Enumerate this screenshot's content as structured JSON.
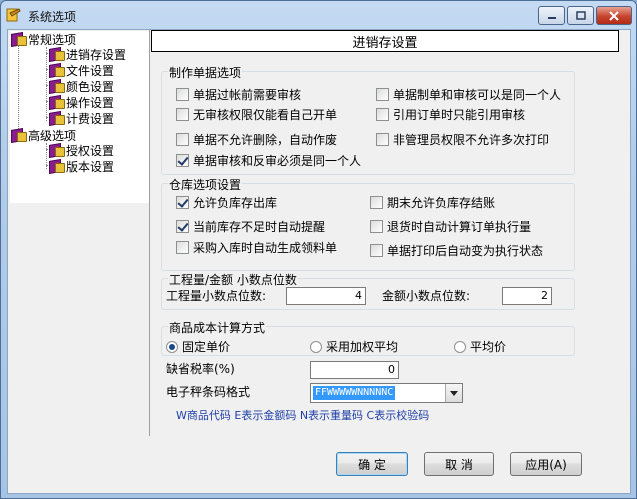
{
  "window": {
    "title": "系统选项"
  },
  "tree": {
    "general": "常规选项",
    "general_items": [
      "进销存设置",
      "文件设置",
      "颜色设置",
      "操作设置",
      "计费设置"
    ],
    "advanced": "高级选项",
    "advanced_items": [
      "授权设置",
      "版本设置"
    ]
  },
  "panel": {
    "header": "进销存设置",
    "doc_group": {
      "title": "制作单据选项",
      "options": [
        {
          "label": "单据过帐前需要审核",
          "checked": false
        },
        {
          "label": "单据制单和审核可以是同一个人",
          "checked": false
        },
        {
          "label": "无审核权限仅能看自己开单",
          "checked": false
        },
        {
          "label": "引用订单时只能引用审核",
          "checked": false
        },
        {
          "label": "单据不允许删除，自动作废",
          "checked": false
        },
        {
          "label": "非管理员权限不允许多次打印",
          "checked": false
        },
        {
          "label": "单据审核和反审必须是同一个人",
          "checked": true
        }
      ]
    },
    "stock_group": {
      "title": "仓库选项设置",
      "options": [
        {
          "label": "允许负库存出库",
          "checked": true
        },
        {
          "label": "期末允许负库存结账",
          "checked": false
        },
        {
          "label": "当前库存不足时自动提醒",
          "checked": true
        },
        {
          "label": "退货时自动计算订单执行量",
          "checked": false
        },
        {
          "label": "采购入库时自动生成领料单",
          "checked": false
        },
        {
          "label": "单据打印后自动变为执行状态",
          "checked": false
        }
      ]
    },
    "decimal_group": {
      "title": "工程量/金额 小数点位数",
      "qty_label": "工程量小数点位数:",
      "qty_value": "4",
      "amount_label": "金额小数点位数:",
      "amount_value": "2"
    },
    "cost_group": {
      "title": "商品成本计算方式",
      "options": [
        "固定单价",
        "采用加权平均",
        "平均价"
      ],
      "selected_index": 0
    },
    "tax": {
      "label": "缺省税率(%)",
      "value": "0"
    },
    "barcode": {
      "label": "电子秤条码格式",
      "value": "FFWWWWWNNNNNC",
      "hint": "W商品代码 E表示金额码 N表示重量码 C表示校验码"
    }
  },
  "buttons": {
    "ok": "确  定",
    "cancel": "取  消",
    "apply": "应用(A)"
  }
}
